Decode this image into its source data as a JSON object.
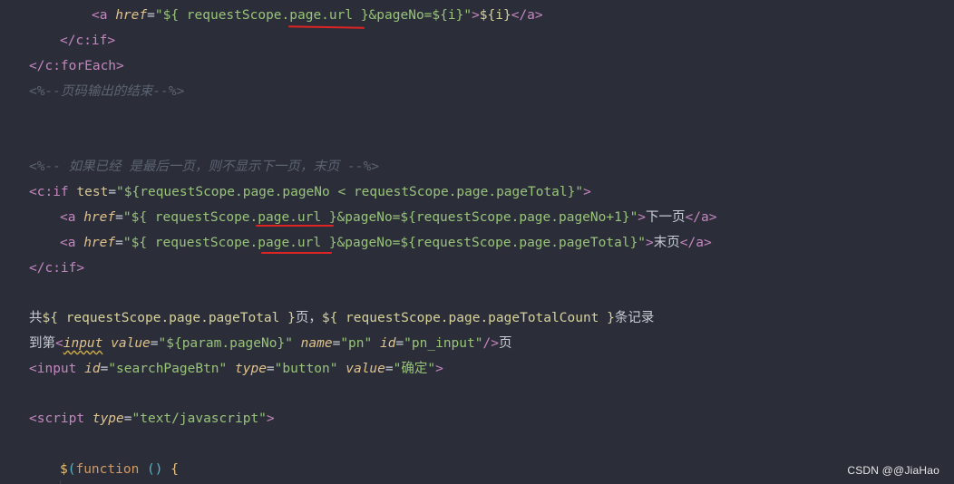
{
  "editor": {
    "lines": [
      {
        "tag_open": "<a ",
        "href_attr": "href",
        "eq": "=",
        "href_value": "\"${ requestScope.page.url }&pageNo=${i}\"",
        "gt": ">",
        "link_text": "${i}",
        "tag_close": "</a>"
      },
      {
        "tag_close": "</c:if>"
      },
      {
        "tag_close": "</c:forEach>"
      },
      {
        "comment": "<%--页码输出的结束--%>"
      },
      {
        "comment": "<%-- 如果已经 是最后一页，则不显示下一页，末页 --%>"
      },
      {
        "tag_open": "<c:if ",
        "attr": "test",
        "eq": "=",
        "value": "\"${requestScope.page.pageNo < requestScope.page.pageTotal}\"",
        "gt": ">"
      },
      {
        "tag_open": "<a ",
        "href_attr": "href",
        "eq": "=",
        "href_value": "\"${ requestScope.page.url }&pageNo=${requestScope.page.pageNo+1}\"",
        "gt": ">",
        "link_text": "下一页",
        "tag_close": "</a>"
      },
      {
        "tag_open": "<a ",
        "href_attr": "href",
        "eq": "=",
        "href_value": "\"${ requestScope.page.url }&pageNo=${requestScope.page.pageTotal}\"",
        "gt": ">",
        "link_text": "末页",
        "tag_close": "</a>"
      },
      {
        "tag_close": "</c:if>"
      },
      {
        "text_a": "共",
        "expr_a": "${ requestScope.page.pageTotal }",
        "text_b": "页，",
        "expr_b": "${ requestScope.page.pageTotalCount }",
        "text_c": "条记录"
      },
      {
        "text_a": "到第",
        "tag_lt": "<",
        "tag_name": "input",
        "attr_value": "value",
        "eq1": "=",
        "value_value": "\"${param.pageNo}\"",
        "attr_name": "name",
        "eq2": "=",
        "name_value": "\"pn\"",
        "attr_id": "id",
        "eq3": "=",
        "id_value": "\"pn_input\"",
        "tag_end": "/>",
        "text_b": "页"
      },
      {
        "tag_open": "<input ",
        "attr_id": "id",
        "eq1": "=",
        "id_value": "\"searchPageBtn\"",
        "attr_type": "type",
        "eq2": "=",
        "type_value": "\"button\"",
        "attr_value": "value",
        "eq3": "=",
        "value_value": "\"确定\"",
        "gt": ">"
      },
      {
        "tag_open": "<script ",
        "attr_type": "type",
        "eq": "=",
        "type_value": "\"text/javascript\"",
        "gt": ">"
      },
      {
        "dollar": "$",
        "lparen": "(",
        "keyword": "function",
        "params": " () ",
        "brace": "{"
      }
    ]
  },
  "watermark": {
    "text": "CSDN @@JiaHao"
  },
  "colors": {
    "background": "#2b2e39",
    "tag": "#c586c0",
    "string": "#98c379",
    "comment": "#5c6370",
    "underline_annotation": "#e02323"
  }
}
